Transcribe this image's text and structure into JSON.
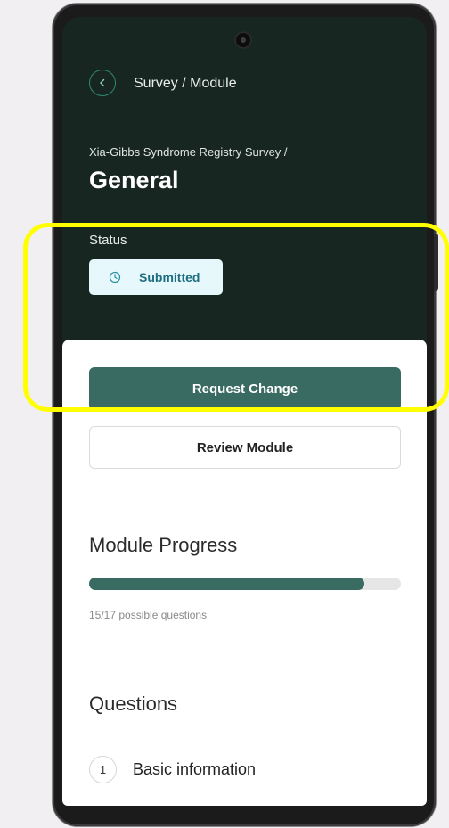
{
  "header": {
    "back_icon": "chevron-left-icon",
    "breadcrumb": "Survey / Module",
    "survey_name": "Xia-Gibbs Syndrome Registry Survey /",
    "title": "General"
  },
  "status": {
    "label": "Status",
    "badge_icon": "clock-icon",
    "badge_text": "Submitted"
  },
  "actions": {
    "request_change": "Request Change",
    "review_module": "Review Module"
  },
  "progress": {
    "title": "Module Progress",
    "answered": 15,
    "total": 17,
    "caption": "15/17 possible questions"
  },
  "questions": {
    "title": "Questions",
    "items": [
      {
        "number": "1",
        "label": "Basic information"
      }
    ]
  },
  "colors": {
    "dark_bg": "#182622",
    "accent": "#3a6b62",
    "badge_bg": "#e6f8fb",
    "highlight": "#ffff00"
  }
}
